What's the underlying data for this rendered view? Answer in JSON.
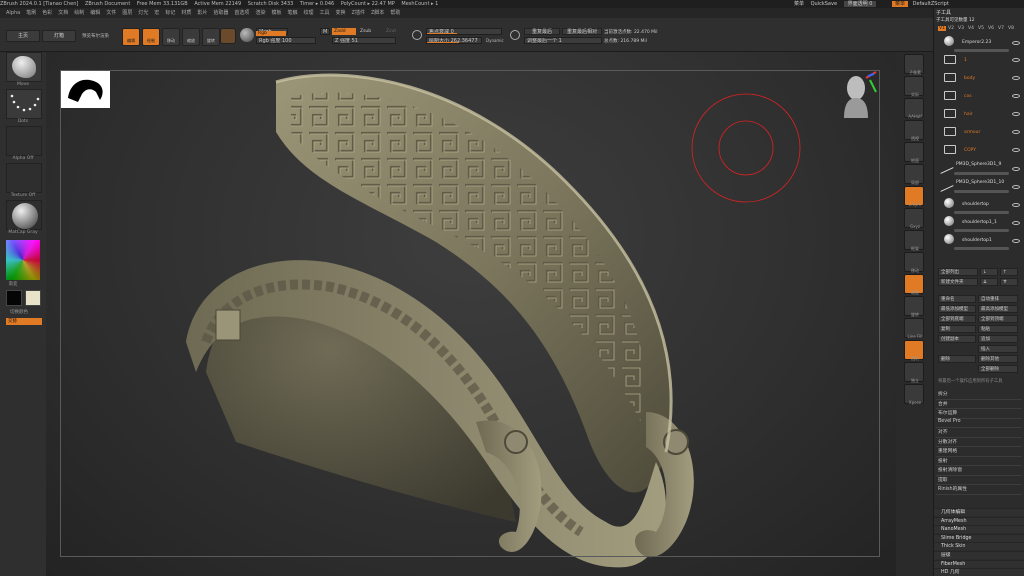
{
  "titlebar": {
    "app": "ZBrush 2024.0.1 [Tianao Chen]",
    "doc": "ZBrush Document",
    "free_mem": "Free Mem 33.131GB",
    "active_mem": "Active Mem 22149",
    "scratch": "Scratch Disk 3433",
    "timer": "Timer ▸ 0.046",
    "polycount": "PolyCount ▸ 22.47 MP",
    "meshcount": "MeshCount ▸ 1",
    "menus_btn": "菜单",
    "quicksave": "QuickSave",
    "transparency": "界面透明 0",
    "menu_chip": "菜单",
    "script": "DefaultZScript"
  },
  "menubar": [
    "Alpha",
    "笔刷",
    "色彩",
    "文档",
    "绘制",
    "编辑",
    "文件",
    "图层",
    "灯光",
    "宏",
    "标记",
    "材质",
    "影片",
    "拾取器",
    "首选项",
    "渲染",
    "模板",
    "笔触",
    "纹理",
    "工具",
    "变换",
    "Z插件",
    "Z脚本",
    "帮助"
  ],
  "shelf": {
    "home": "主页",
    "lightbox": "灯箱",
    "lightbox_sub": "预览布尔渲染",
    "edit": "编辑",
    "draw": "绘制",
    "move": "移动",
    "scale": "缩放",
    "rotate": "旋转",
    "mrgb": "Mrgb",
    "rgb": "Rgb",
    "m": "M",
    "zadd": "Zadd",
    "zsub": "Zsub",
    "zcut": "Zcut",
    "rgb_intensity": "Rgb 强度 100",
    "z_intensity": "Z 强度 51",
    "focal_shift": "焦点衰减 0",
    "draw_size": "绘制大小 262.36477",
    "dynamic": "Dynamic",
    "backface": "重复最后",
    "backface_rel": "重复最后相对",
    "adjust_last": "调整最后一个 1",
    "active_points": "当前激活点数: 22.470 Mil",
    "total_points": "总点数: 216.789 Mil"
  },
  "leftpanel": {
    "brush": "Move",
    "stroke": "Dots",
    "alpha": "Alpha Off",
    "texture": "Texture Off",
    "material": "MatCap Gray",
    "gradient": "渐变",
    "switch_color": "切换颜色",
    "alternate": "交替"
  },
  "righttools": [
    "子像素",
    "实际",
    "AAHalf",
    "透视",
    "地面",
    "局部",
    "L.Sym",
    "Gxyz",
    "框架",
    "移动",
    "缩放",
    "旋转",
    "Line Fill",
    "透明",
    "独立",
    "Xpose"
  ],
  "subtool": {
    "header": "子工具",
    "list_header": "子工具可见数量 12",
    "vtabs": [
      "V1",
      "V2",
      "V3",
      "V4",
      "V5",
      "V6",
      "V7",
      "V8"
    ],
    "items": [
      {
        "type": "ball",
        "name": "Emperor2.23"
      },
      {
        "type": "folder",
        "name": "1"
      },
      {
        "type": "folder",
        "name": "body"
      },
      {
        "type": "folder",
        "name": "cos"
      },
      {
        "type": "folder",
        "name": "hair"
      },
      {
        "type": "folder",
        "name": "armour"
      },
      {
        "type": "folder",
        "name": "COPY"
      },
      {
        "type": "stroke",
        "name": "PM3D_Sphere3D1_9"
      },
      {
        "type": "stroke",
        "name": "PM3D_Sphere3D1_10"
      },
      {
        "type": "ball",
        "name": "shouldertop"
      },
      {
        "type": "ball",
        "name": "shouldertop1_1"
      },
      {
        "type": "ball",
        "name": "shouldertop1"
      }
    ],
    "all_list": "全部列出",
    "new_folder": "新建文件夹",
    "all_low": "最低",
    "all_high": "最高",
    "btns": [
      [
        "重命名",
        "自动重排"
      ],
      [
        "最低添加模型",
        "最高添加模型"
      ],
      [
        "全部到底端",
        "全部到顶端"
      ],
      [
        "复制",
        "粘贴"
      ],
      [
        "创建副本",
        "追加"
      ],
      [
        "",
        "插入"
      ],
      [
        "删除",
        "删除其他"
      ],
      [
        "",
        "全部删除"
      ]
    ],
    "hint": "将最后一个操作应用到所有子工具",
    "menus": [
      "拆分",
      "合并",
      "布尔运算",
      "Bevel Pro",
      "对齐",
      "分散对齐",
      "重建网格",
      "投射",
      "投射清除窗",
      "提取",
      "Rinish的属性"
    ],
    "submenus": [
      "几何体编辑",
      "ArrayMesh",
      "NanoMesh",
      "Slime Bridge",
      "Thick Skin",
      "层级",
      "FiberMesh",
      "HD 几何"
    ]
  },
  "colors": {
    "accent": "#e07a24",
    "helmet": "#8a8468"
  },
  "icons": [
    "bust-navigation-icon",
    "xyz-axis-icon",
    "brush-cursor-icon",
    "silhouette-icon",
    "eye-icon"
  ]
}
